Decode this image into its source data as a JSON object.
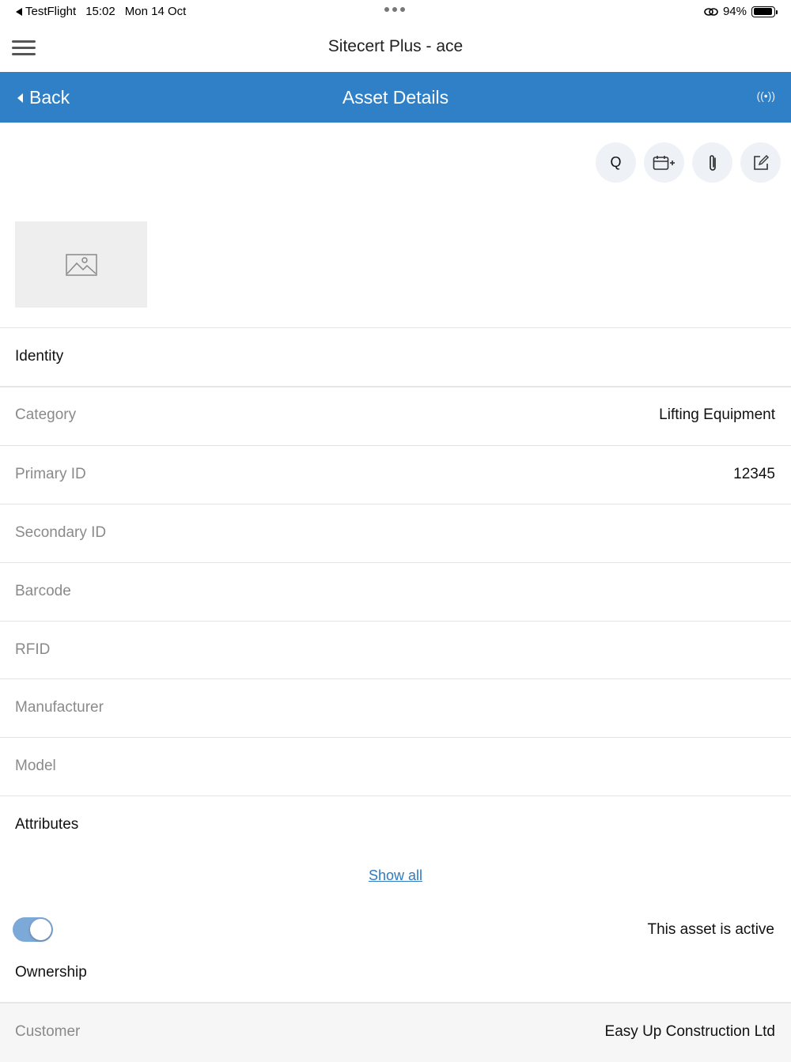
{
  "status_bar": {
    "back_app": "TestFlight",
    "time": "15:02",
    "date": "Mon 14 Oct",
    "battery": "94%",
    "battery_level": 0.94
  },
  "app": {
    "title": "Sitecert Plus - ace"
  },
  "nav": {
    "back_label": "Back",
    "title": "Asset Details",
    "rfid_glyph": "((•))"
  },
  "actions": [
    {
      "name": "search-icon",
      "glyph": "Q"
    },
    {
      "name": "calendar-add-icon"
    },
    {
      "name": "paperclip-icon"
    },
    {
      "name": "edit-icon"
    }
  ],
  "identity": {
    "title": "Identity",
    "rows": [
      {
        "label": "Category",
        "value": "Lifting Equipment"
      },
      {
        "label": "Primary ID",
        "value": "12345"
      },
      {
        "label": "Secondary ID",
        "value": ""
      },
      {
        "label": "Barcode",
        "value": ""
      },
      {
        "label": "RFID",
        "value": ""
      },
      {
        "label": "Manufacturer",
        "value": ""
      },
      {
        "label": "Model",
        "value": ""
      }
    ]
  },
  "attributes": {
    "title": "Attributes",
    "show_all": "Show all"
  },
  "active_toggle": {
    "label": "This asset is active",
    "on": true
  },
  "ownership": {
    "title": "Ownership",
    "rows": [
      {
        "label": "Customer",
        "value": "Easy Up Construction Ltd"
      }
    ]
  },
  "colors": {
    "nav_blue": "#2f80c6",
    "toggle_on": "#7da9d9",
    "link": "#2f7ac0"
  }
}
